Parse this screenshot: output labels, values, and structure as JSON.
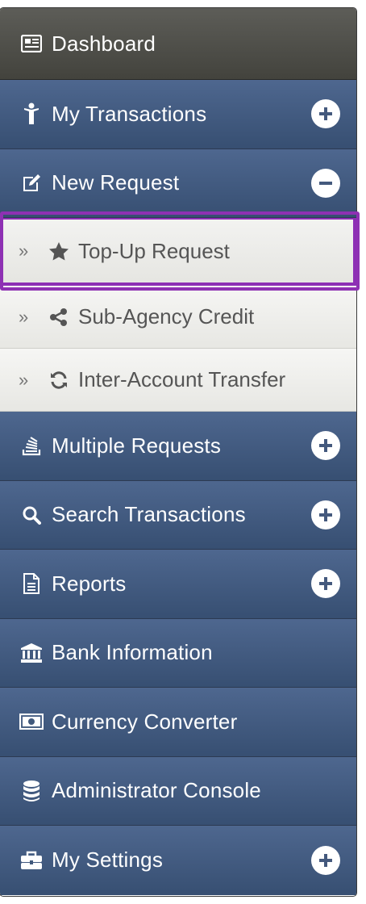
{
  "menu": {
    "dashboard": {
      "label": "Dashboard",
      "icon": "dashboard-icon"
    },
    "items": [
      {
        "label": "My Transactions",
        "icon": "person-icon",
        "toggle": "plus"
      },
      {
        "label": "New Request",
        "icon": "edit-icon",
        "toggle": "minus"
      },
      {
        "label": "Multiple Requests",
        "icon": "stack-icon",
        "toggle": "plus"
      },
      {
        "label": "Search Transactions",
        "icon": "search-icon",
        "toggle": "plus"
      },
      {
        "label": "Reports",
        "icon": "document-icon",
        "toggle": "plus"
      },
      {
        "label": "Bank Information",
        "icon": "bank-icon",
        "toggle": ""
      },
      {
        "label": "Currency Converter",
        "icon": "money-icon",
        "toggle": ""
      },
      {
        "label": "Administrator Console",
        "icon": "database-icon",
        "toggle": ""
      },
      {
        "label": "My Settings",
        "icon": "briefcase-icon",
        "toggle": "plus"
      }
    ],
    "submenu": [
      {
        "label": "Top-Up Request",
        "icon": "star-icon",
        "active": true
      },
      {
        "label": "Sub-Agency Credit",
        "icon": "share-icon"
      },
      {
        "label": "Inter-Account Transfer",
        "icon": "refresh-icon"
      }
    ],
    "raquo": "»"
  },
  "colors": {
    "dashboard_bg": "#4f4f4a",
    "item_bg": "#435b80",
    "submenu_bg": "#efefec",
    "highlight": "#8e31b3"
  }
}
